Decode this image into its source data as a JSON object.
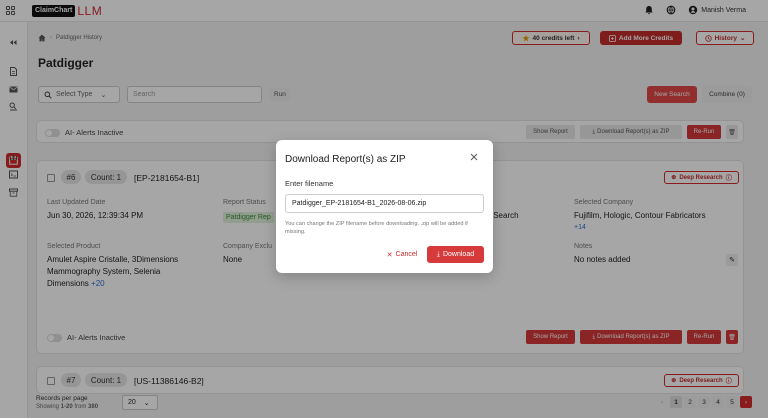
{
  "app": {
    "logo_part1": "ClaimChart",
    "logo_part2": "LLM",
    "user_name": "Manish Verma"
  },
  "breadcrumb": {
    "current": "Patdigger History"
  },
  "header": {
    "credits": "40 credits left",
    "add_credits": "Add More Credits",
    "history": "History"
  },
  "page": {
    "title": "Patdigger"
  },
  "search": {
    "select_type": "Select Type",
    "placeholder": "Search",
    "run": "Run",
    "new_search": "New Search",
    "combine": "Combine (0)"
  },
  "alerts_bar": {
    "toggle_label": "AI- Alerts Inactive",
    "show_report": "Show Report",
    "download_zip": "Download Report(s) as ZIP",
    "rerun": "Re-Run"
  },
  "card1": {
    "number": "#6",
    "count": "Count: 1",
    "doc_id": "[EP-2181654-B1]",
    "deep_research": "Deep Research",
    "last_updated_label": "Last Updated Date",
    "last_updated": "Jun 30, 2026, 12:39:34 PM",
    "report_status_label": "Report Status",
    "report_status": "Patdigger Rep",
    "search_type_partial": "y Search",
    "selected_company_label": "Selected Company",
    "selected_company": "Fujifilm, Hologic, Contour Fabricators",
    "company_more": "+14",
    "selected_product_label": "Selected Product",
    "selected_product_1": "Amulet Aspire Cristalle, 3Dimensions",
    "selected_product_2": "Mammography System, Selenia",
    "selected_product_3": "Dimensions",
    "product_more": "+20",
    "company_excl_label": "Company Exclu",
    "company_excl": "None",
    "notes_label": "Notes",
    "notes": "No notes added",
    "toggle_label": "AI- Alerts Inactive",
    "show_report": "Show Report",
    "download_zip": "Download Report(s) as ZIP",
    "rerun": "Re-Run"
  },
  "card2": {
    "number": "#7",
    "count": "Count: 1",
    "doc_id": "[US-11386146-B2]",
    "deep_research": "Deep Research"
  },
  "footer": {
    "records_label": "Records per page",
    "showing_prefix": "Showing ",
    "showing_range": "1-20",
    "showing_mid": " from ",
    "showing_total": "380",
    "per_page": "20"
  },
  "pagination": {
    "pages": [
      "1",
      "2",
      "3",
      "4",
      "5"
    ]
  },
  "modal": {
    "title": "Download Report(s) as ZIP",
    "label": "Enter filename",
    "filename": "Patdigger_EP-2181654-B1_2026-08-06.zip",
    "help": "You can change the ZIP filename before downloading. .zip will be added if missing.",
    "cancel": "Cancel",
    "download": "Download"
  }
}
